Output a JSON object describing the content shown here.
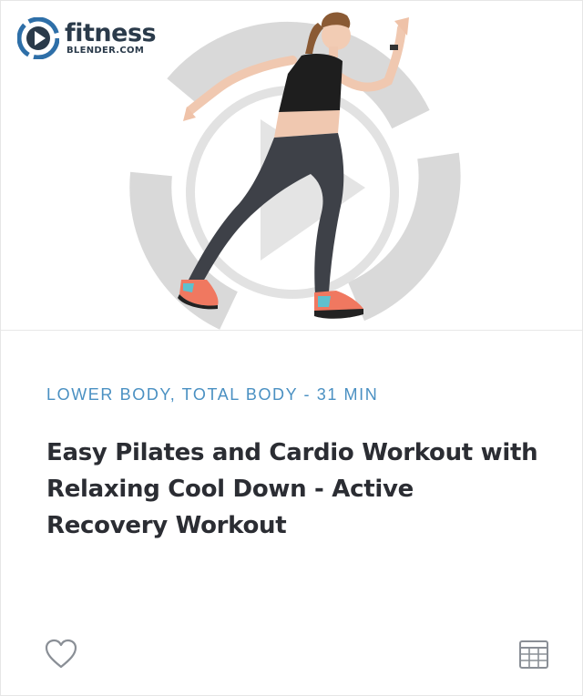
{
  "brand": {
    "name": "fitness",
    "sub": "BLENDER.COM",
    "logo_icon": "play-circle-icon"
  },
  "card": {
    "category": "LOWER BODY, TOTAL BODY - 31 MIN",
    "title_lines": [
      "Easy Pilates and Cardio Workout with",
      "Relaxing Cool Down - Active",
      "Recovery Workout"
    ],
    "favorite_icon": "heart-icon",
    "calendar_icon": "calendar-icon"
  },
  "colors": {
    "accent": "#4a90c2",
    "title": "#2b2d33",
    "logo_blue": "#2e6fa8",
    "icon_gray": "#8a8f96"
  }
}
